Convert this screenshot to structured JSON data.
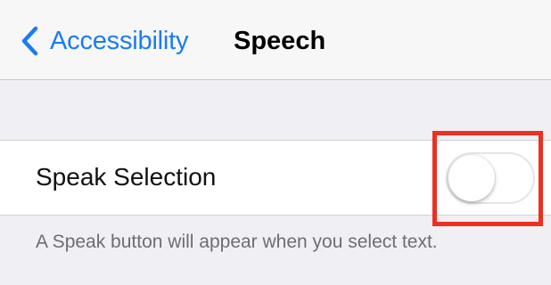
{
  "nav": {
    "back_label": "Accessibility",
    "title": "Speech",
    "accent_color": "#1a7cf5"
  },
  "settings": {
    "speak_selection": {
      "label": "Speak Selection",
      "toggle_state": "off",
      "highlight_color": "#ef2f1f"
    },
    "footer": "A Speak button will appear when you select text."
  },
  "icons": {
    "back": "chevron-left-icon"
  }
}
